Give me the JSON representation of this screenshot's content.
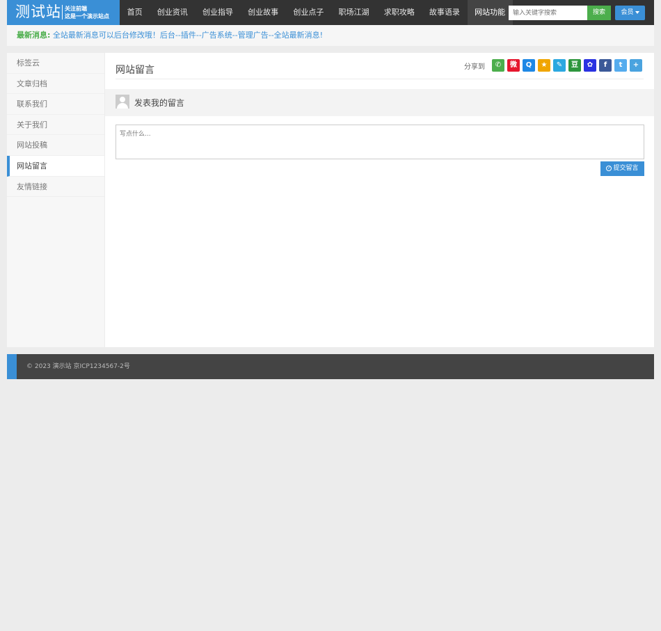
{
  "header": {
    "logo_main": "测试站",
    "logo_line1": "关注前端",
    "logo_line2": "这是一个演示站点",
    "nav": [
      "首页",
      "创业资讯",
      "创业指导",
      "创业故事",
      "创业点子",
      "职场江湖",
      "求职攻略",
      "故事语录",
      "网站功能"
    ],
    "active_nav": "网站功能",
    "search_placeholder": "输入关键字搜索",
    "search_button": "搜索",
    "member_button": "会员"
  },
  "notice": {
    "label": "最新消息:",
    "message": "全站最新消息可以后台修改哦！后台--插件--广告系统--管理广告--全站最新消息!"
  },
  "sidebar": {
    "items": [
      "标签云",
      "文章归档",
      "联系我们",
      "关于我们",
      "网站投稿",
      "网站留言",
      "友情链接"
    ],
    "active": "网站留言"
  },
  "main": {
    "title": "网站留言",
    "share_label": "分享到",
    "share_icons": [
      {
        "name": "wechat-icon",
        "color": "#4cae4c",
        "glyph": "✆"
      },
      {
        "name": "weibo-icon",
        "color": "#e6162d",
        "glyph": "微"
      },
      {
        "name": "qq-icon",
        "color": "#1e88e5",
        "glyph": "Q"
      },
      {
        "name": "qzone-icon",
        "color": "#f0a500",
        "glyph": "★"
      },
      {
        "name": "tencent-weibo-icon",
        "color": "#2ba8e0",
        "glyph": "✎"
      },
      {
        "name": "douban-icon",
        "color": "#2e963d",
        "glyph": "豆"
      },
      {
        "name": "baidu-icon",
        "color": "#2932e1",
        "glyph": "✿"
      },
      {
        "name": "facebook-icon",
        "color": "#3b5998",
        "glyph": "f"
      },
      {
        "name": "twitter-icon",
        "color": "#55acee",
        "glyph": "t"
      },
      {
        "name": "more-share-icon",
        "color": "#4aa3df",
        "glyph": "+"
      }
    ],
    "comment_title": "发表我的留言",
    "textarea_placeholder": "写点什么...",
    "submit_button": "提交留言"
  },
  "footer": {
    "text": "© 2023 演示站   京ICP1234567-2号"
  }
}
